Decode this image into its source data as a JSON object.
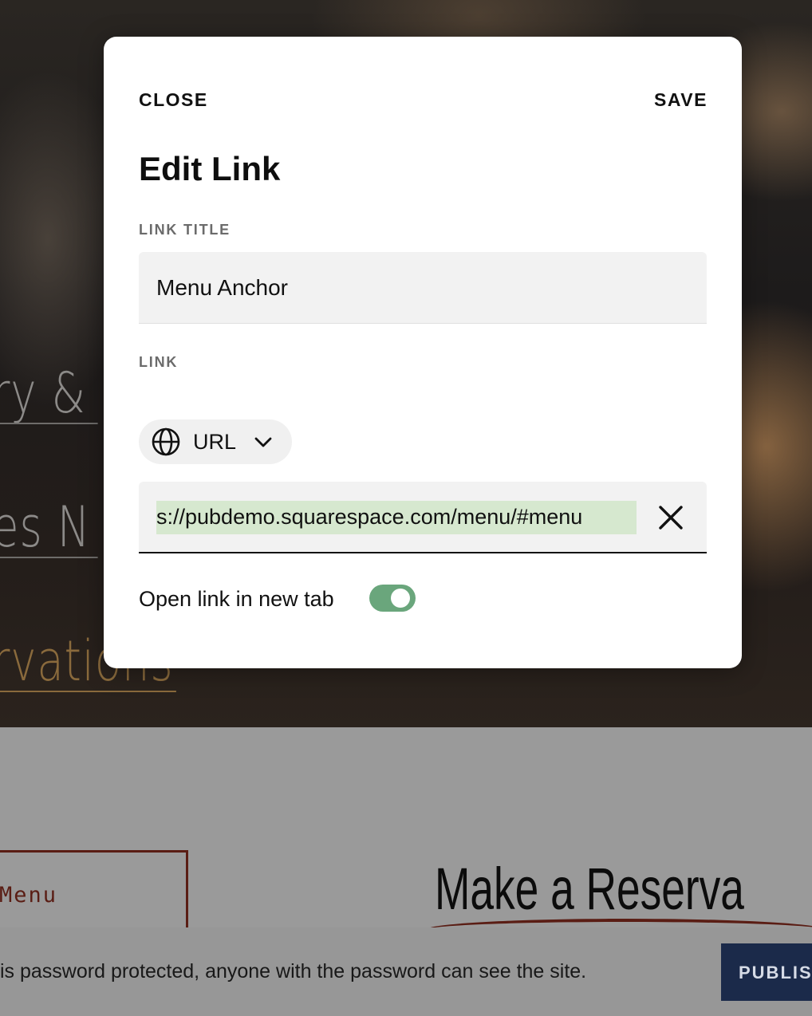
{
  "background_site": {
    "nav_links": [
      "ry & A",
      "es N",
      "rvations"
    ],
    "menu_button_label": "Menu",
    "reservation_heading": "Make a Reserva",
    "footer_notice": "is password protected, anyone with the password can see the site.",
    "publish_button_label": "PUBLIS"
  },
  "modal": {
    "close_label": "CLOSE",
    "save_label": "SAVE",
    "title": "Edit Link",
    "link_title_label": "LINK TITLE",
    "link_title_value": "Menu Anchor",
    "link_label": "LINK",
    "link_type": {
      "icon": "globe-icon",
      "selected": "URL"
    },
    "url_value": "s://pubdemo.squarespace.com/menu/#menu",
    "new_tab_label": "Open link in new tab",
    "new_tab_enabled": true
  },
  "colors": {
    "toggle_on": "#6aa67c",
    "url_selection": "#d6e8cf",
    "accent_dark_red": "#5a1d14",
    "publish_navy": "#1b2a4a"
  }
}
